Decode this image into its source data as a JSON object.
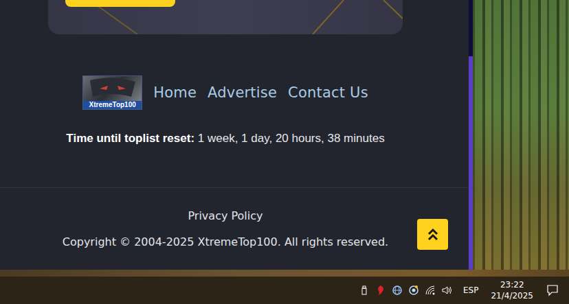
{
  "footer": {
    "logo": "XtremeTop100",
    "links": [
      "Home",
      "Advertise",
      "Contact Us"
    ],
    "reset": {
      "label": "Time until toplist reset:",
      "value": "1 week, 1 day, 20 hours, 38 minutes"
    },
    "privacy": "Privacy Policy",
    "copyright": "Copyright © 2004-2025 XtremeTop100. All rights reserved."
  },
  "taskbar": {
    "language": "ESP",
    "time": "23:22",
    "date": "21/4/2025"
  }
}
